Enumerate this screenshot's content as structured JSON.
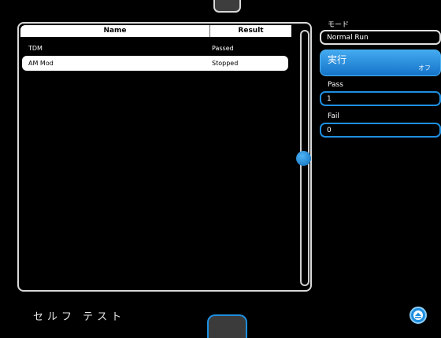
{
  "table": {
    "headers": {
      "name": "Name",
      "result": "Result"
    },
    "rows": [
      {
        "name": "TDM",
        "result": "Passed",
        "selected": false
      },
      {
        "name": "AM Mod",
        "result": "Stopped",
        "selected": true
      }
    ]
  },
  "mode": {
    "label": "モード",
    "value": "Normal Run"
  },
  "run": {
    "label": "実行",
    "state": "オフ"
  },
  "pass": {
    "label": "Pass",
    "value": "1"
  },
  "fail": {
    "label": "Fail",
    "value": "0"
  },
  "footer": {
    "title": "セルフ テスト"
  },
  "icons": {
    "scroll_up": "eject-up-icon"
  },
  "colors": {
    "accent": "#1e8fe0",
    "background": "#000000"
  }
}
